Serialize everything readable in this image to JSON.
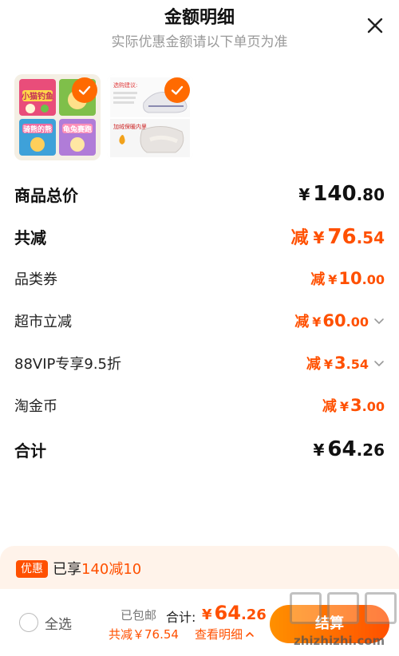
{
  "header": {
    "title": "金额明细",
    "subtitle": "实际优惠金额请以下单页为准"
  },
  "products": [
    {
      "name": "kids-picture-books",
      "image_text": [
        "小猫钓鱼",
        "骑熊的熊",
        "龟兔赛跑"
      ]
    },
    {
      "name": "kids-shoes",
      "image_text": [
        "选购建议:",
        "加绒保暖内里"
      ]
    }
  ],
  "rows": {
    "subtotal": {
      "label": "商品总价",
      "prefix": "",
      "currency": "¥",
      "int": "140",
      "dec": ".80"
    },
    "total_saved": {
      "label": "共减",
      "prefix": "减",
      "currency": "¥",
      "int": "76",
      "dec": ".54"
    },
    "category_coupon": {
      "label": "品类券",
      "prefix": "减",
      "currency": "¥",
      "int": "10",
      "dec": ".00"
    },
    "supermarket_discount": {
      "label": "超市立减",
      "prefix": "减",
      "currency": "¥",
      "int": "60",
      "dec": ".00"
    },
    "vip_discount": {
      "label": "88VIP专享9.5折",
      "prefix": "减",
      "currency": "¥",
      "int": "3",
      "dec": ".54"
    },
    "tao_coin": {
      "label": "淘金币",
      "prefix": "减",
      "currency": "¥",
      "int": "3",
      "dec": ".00"
    },
    "total": {
      "label": "合计",
      "prefix": "",
      "currency": "¥",
      "int": "64",
      "dec": ".26"
    }
  },
  "promo": {
    "badge": "优惠",
    "text_prefix": "已享",
    "text_highlight": "140减10"
  },
  "bottom_bar": {
    "select_all": "全选",
    "shipping": "已包邮",
    "total_label": "合计:",
    "total_currency": "¥",
    "total_int": "64",
    "total_dec": ".26",
    "saved": "共减￥76.54",
    "details": "查看明细",
    "checkout": "结算"
  },
  "watermark": {
    "url": "zhizhizhi.com"
  },
  "colors": {
    "accent": "#ff5000",
    "checkout_gradient_start": "#ff9000",
    "promo_bg": "#fff3ea"
  },
  "icons": {
    "close": "close-icon",
    "check": "check-icon",
    "chevron": "chevron-down-icon",
    "chevron_up": "chevron-up-icon"
  }
}
